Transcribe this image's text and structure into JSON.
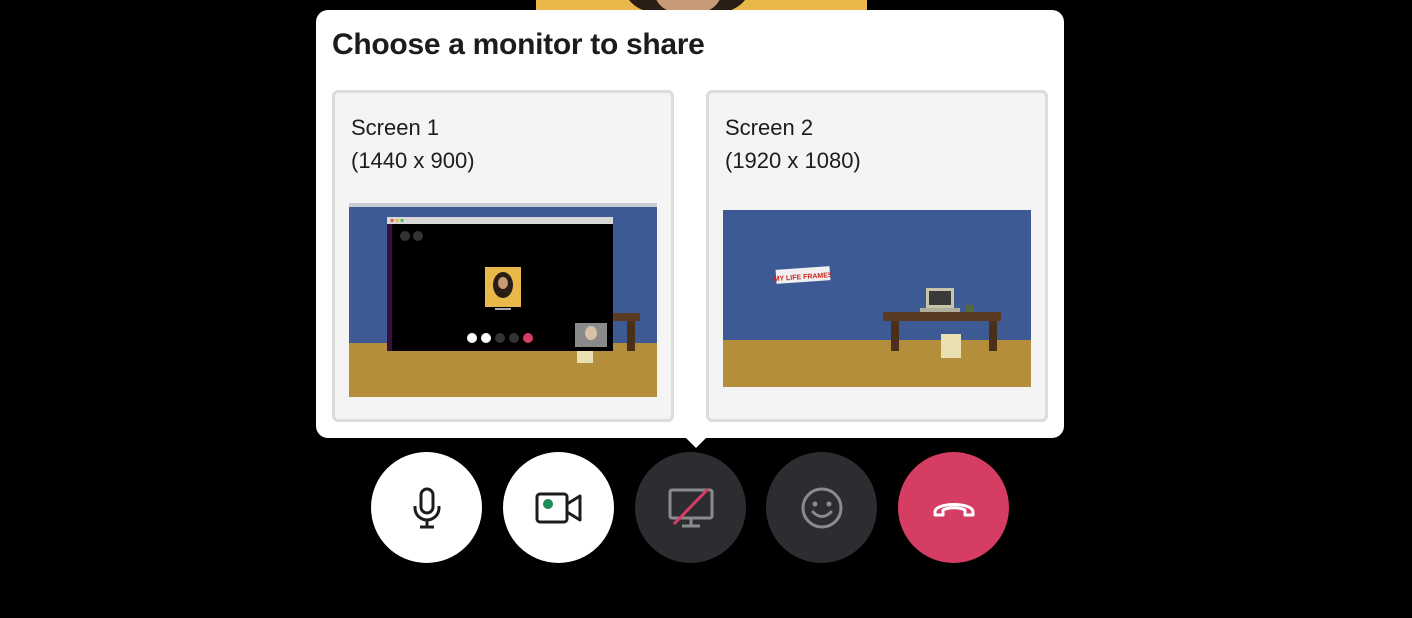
{
  "popover": {
    "title": "Choose a monitor to share",
    "screens": [
      {
        "name": "Screen 1",
        "resolution": "(1440 x 900)"
      },
      {
        "name": "Screen 2",
        "resolution": "(1920 x 1080)"
      }
    ],
    "thumbnail_sign_text": "MY LIFE FRAMES"
  },
  "controls": [
    {
      "name": "microphone",
      "icon": "microphone-icon",
      "state": "on"
    },
    {
      "name": "video",
      "icon": "video-camera-icon",
      "state": "on"
    },
    {
      "name": "screen-share",
      "icon": "screen-share-off-icon",
      "state": "off"
    },
    {
      "name": "reactions",
      "icon": "smiley-icon"
    },
    {
      "name": "leave-call",
      "icon": "hang-up-icon"
    }
  ],
  "colors": {
    "background": "#000000",
    "popover": "#ffffff",
    "leave_button": "#d63d63",
    "dark_button": "#2c2d30",
    "video_accent": "#1f8a5b"
  }
}
